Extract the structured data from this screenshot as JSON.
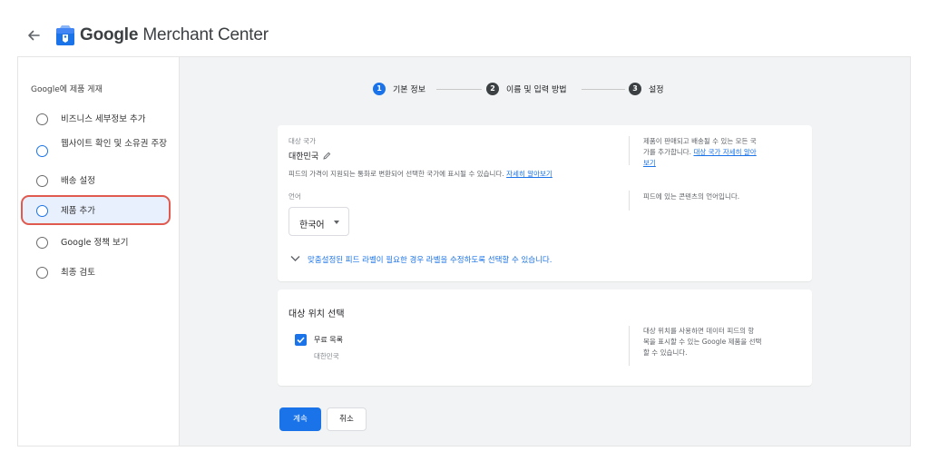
{
  "header": {
    "brand_bold": "Google",
    "brand_rest": " Merchant Center"
  },
  "sidebar": {
    "title": "Google에 제품 게재",
    "items": [
      {
        "label": "비즈니스 세부정보 추가"
      },
      {
        "label": "웹사이트 확인 및 소유권 주장"
      },
      {
        "label": "배송 설정"
      },
      {
        "label": "제품 추가"
      },
      {
        "label": "Google 정책 보기"
      },
      {
        "label": "최종 검토"
      }
    ]
  },
  "stepper": [
    {
      "num": "1",
      "label": "기본 정보"
    },
    {
      "num": "2",
      "label": "이름 및 입력 방법"
    },
    {
      "num": "3",
      "label": "설정"
    }
  ],
  "country": {
    "label": "대상 국가",
    "value": "대한민국",
    "help": "피드의 가격이 지원되는 통화로 변환되어 선택한 국가에 표시될 수 있습니다.",
    "help_link": "자세히 알아보기",
    "side_text_1": "제품이 판매되고 배송될 수 있는 모든 국",
    "side_text_2_pre": "가를 추가합니다. ",
    "side_link_1": "대상 국가 자세히 알아",
    "side_link_2": "보기"
  },
  "language": {
    "label": "언어",
    "value": "한국어",
    "side_text": "피드에 있는 콘텐츠의 언어입니다."
  },
  "expand_text": "맞춤설정된 피드 라벨이 필요한 경우 라벨을 수정하도록 선택할 수 있습니다.",
  "destination": {
    "title": "대상 위치 선택",
    "checkbox_label": "무료 목록",
    "checkbox_sub": "대한민국",
    "checked": true,
    "side_line_1": "대상 위치를 사용하면 데이터 피드의 항",
    "side_line_2": "목을 표시할 수 있는 Google 제품을 선택",
    "side_line_3": "할 수 있습니다."
  },
  "buttons": {
    "continue": "계속",
    "cancel": "취소"
  },
  "colors": {
    "accent": "#1a73e8",
    "highlight_border": "#e05a4f"
  }
}
